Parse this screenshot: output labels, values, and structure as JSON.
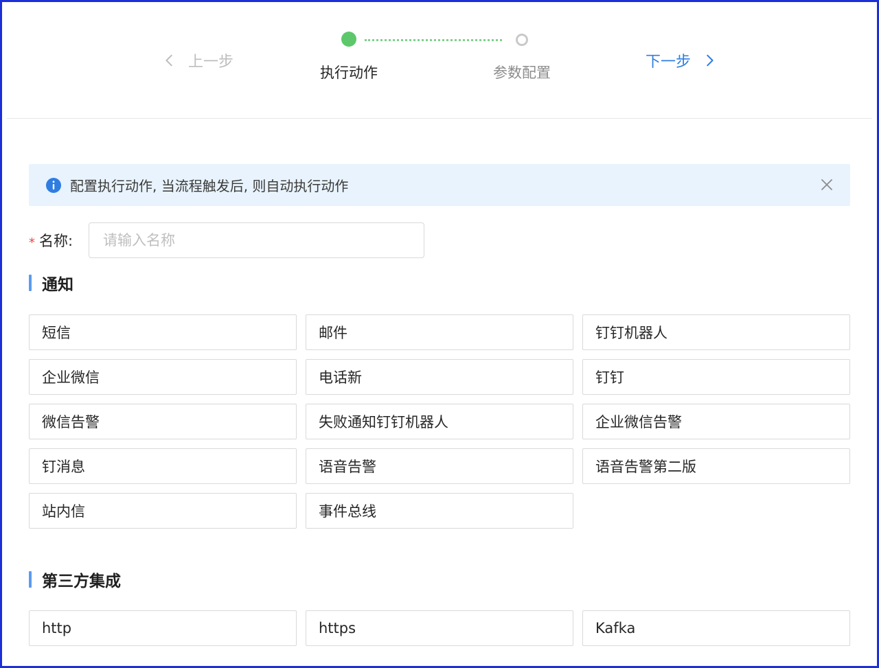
{
  "steps": {
    "prev_label": "上一步",
    "next_label": "下一步",
    "items": [
      {
        "label": "执行动作",
        "status": "active"
      },
      {
        "label": "参数配置",
        "status": "pending"
      }
    ],
    "active_color": "#5cc86b",
    "next_color": "#2f7de1"
  },
  "alert": {
    "text": "配置执行动作, 当流程触发后, 则自动执行动作",
    "icon": "info-icon",
    "close_icon": "close-icon"
  },
  "name_field": {
    "required_mark": "*",
    "label": "名称:",
    "placeholder": "请输入名称",
    "value": ""
  },
  "sections": {
    "notify": {
      "title": "通知",
      "items": [
        "短信",
        "邮件",
        "钉钉机器人",
        "企业微信",
        "电话新",
        "钉钉",
        "微信告警",
        "失败通知钉钉机器人",
        "企业微信告警",
        "钉消息",
        "语音告警",
        "语音告警第二版",
        "站内信",
        "事件总线"
      ]
    },
    "third_party": {
      "title": "第三方集成",
      "items": [
        "http",
        "https",
        "Kafka"
      ]
    }
  }
}
